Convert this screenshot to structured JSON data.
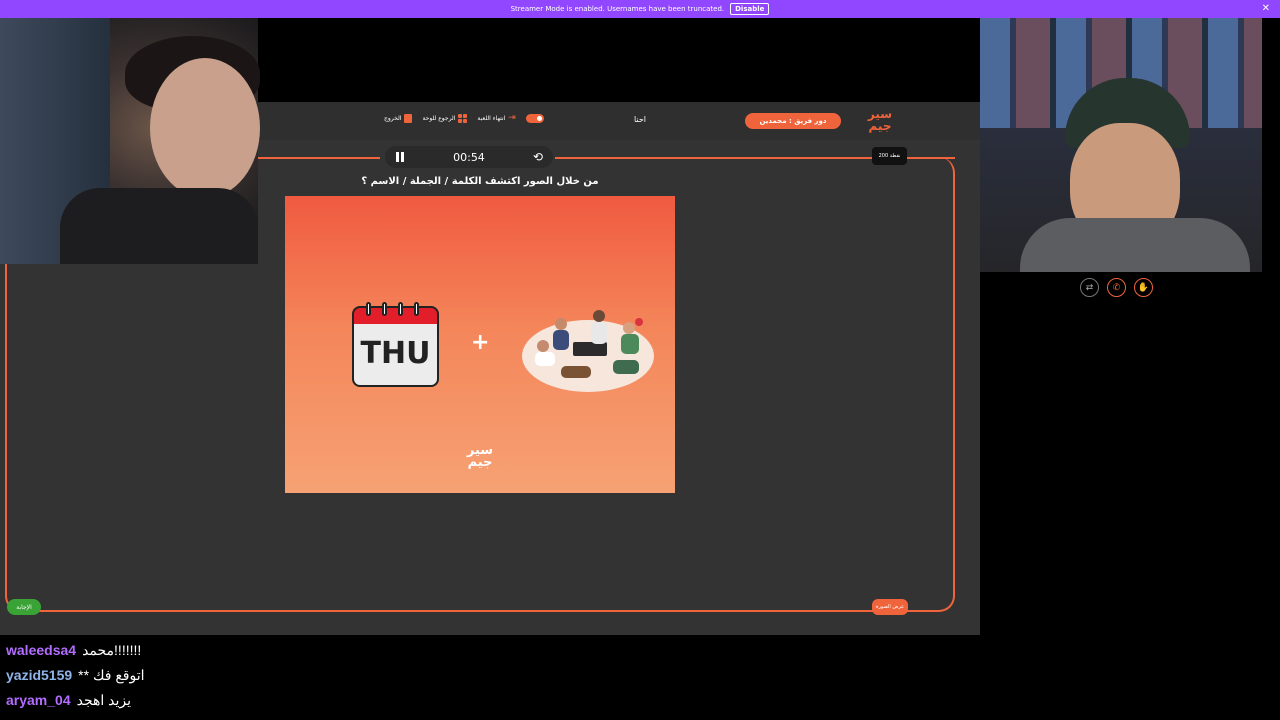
{
  "banner": {
    "text": "Streamer Mode is enabled. Usernames have been truncated.",
    "disable_label": "Disable",
    "close_glyph": "✕"
  },
  "game": {
    "logo": "سير\nجيم",
    "turn_label": "دور فريق : محمدين",
    "team_name": "احنا",
    "controls": {
      "end_game": "انتهاء اللعبة",
      "back_to_board": "الرجوع للوحة",
      "exit": "الخروج"
    },
    "timer": {
      "time": "00:54",
      "reset_glyph": "⟲"
    },
    "points": "200 نقطة",
    "question": "من خلال الصور اكتشف الكلمة / الجملة / الاسم ؟",
    "puzzle": {
      "calendar_text": "THU",
      "plus": "+",
      "logo": "سير\nجيم"
    },
    "answer_button": "الإجابة",
    "show_button": "عرض الصورة"
  },
  "cam_icons": {
    "swap": "⇄",
    "phone": "✆",
    "hand": "✋"
  },
  "chat": [
    {
      "user": "waleedsa4",
      "text": "محمد!!!!!!!",
      "color": "#b26cff"
    },
    {
      "user": "yazid5159",
      "text": "** اتوقع فك",
      "color": "#8fb4e8"
    },
    {
      "user": "aryam_04",
      "text": "يزيد اهجد",
      "color": "#b26cff"
    }
  ],
  "colors": {
    "accent": "#f0643c",
    "twitch_purple": "#9146ff",
    "answer_green": "#3aa335"
  }
}
